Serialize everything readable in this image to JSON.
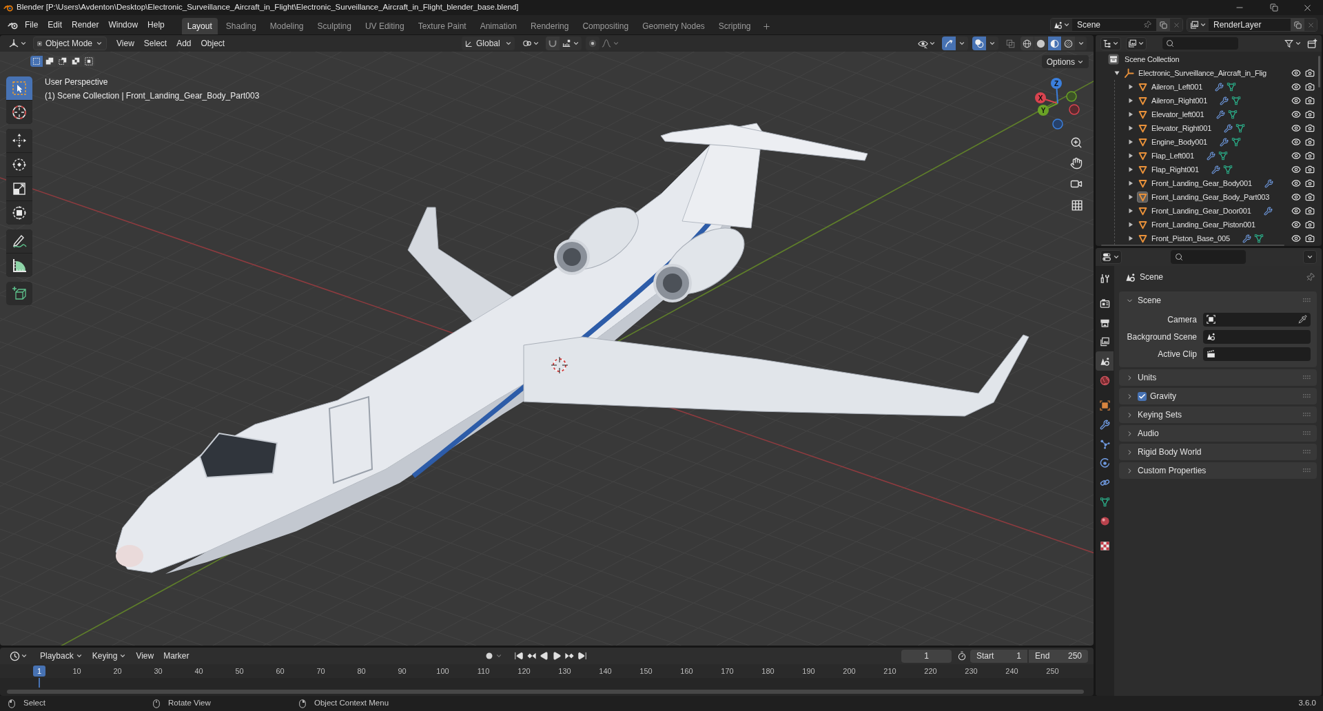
{
  "title_bar": {
    "title": "Blender [P:\\Users\\Avdenton\\Desktop\\Electronic_Surveillance_Aircraft_in_Flight\\Electronic_Surveillance_Aircraft_in_Flight_blender_base.blend]"
  },
  "menu": [
    "File",
    "Edit",
    "Render",
    "Window",
    "Help"
  ],
  "workspaces": [
    {
      "label": "Layout",
      "selected": true
    },
    {
      "label": "Shading",
      "selected": false
    },
    {
      "label": "Modeling",
      "selected": false
    },
    {
      "label": "Sculpting",
      "selected": false
    },
    {
      "label": "UV Editing",
      "selected": false
    },
    {
      "label": "Texture Paint",
      "selected": false
    },
    {
      "label": "Animation",
      "selected": false
    },
    {
      "label": "Rendering",
      "selected": false
    },
    {
      "label": "Compositing",
      "selected": false
    },
    {
      "label": "Geometry Nodes",
      "selected": false
    },
    {
      "label": "Scripting",
      "selected": false
    }
  ],
  "scene_selector": {
    "value": "Scene"
  },
  "view_layer_selector": {
    "value": "RenderLayer"
  },
  "viewport_header": {
    "mode": "Object Mode",
    "menus": [
      "View",
      "Select",
      "Add",
      "Object"
    ],
    "orientation": "Global",
    "snap": false,
    "proportional_editing": false,
    "gizmos": true,
    "overlays": true,
    "xray": false,
    "shading": [
      {
        "kind": "wireframe",
        "selected": false
      },
      {
        "kind": "solid",
        "selected": false
      },
      {
        "kind": "material",
        "selected": true
      },
      {
        "kind": "rendered",
        "selected": false
      }
    ]
  },
  "viewport": {
    "select_modes": [
      {
        "kind": "set",
        "selected": true
      },
      {
        "kind": "extend",
        "selected": false
      },
      {
        "kind": "subtract",
        "selected": false
      },
      {
        "kind": "invert",
        "selected": false
      },
      {
        "kind": "intersect",
        "selected": false
      }
    ],
    "options": "Options",
    "view_name": "User Perspective",
    "context": "(1) Scene Collection | Front_Landing_Gear_Body_Part003",
    "tool_groups": [
      [
        {
          "kind": "select_box",
          "selected": true
        },
        {
          "kind": "cursor",
          "selected": false
        }
      ],
      [
        {
          "kind": "move",
          "selected": false
        },
        {
          "kind": "rotate",
          "selected": false
        },
        {
          "kind": "scale",
          "selected": false
        },
        {
          "kind": "transform",
          "selected": false
        }
      ],
      [
        {
          "kind": "annotate",
          "selected": false
        },
        {
          "kind": "measure",
          "selected": false
        }
      ],
      [
        {
          "kind": "add_cube",
          "selected": false
        }
      ]
    ],
    "gizmo_axes": [
      "X",
      "Y",
      "Z"
    ]
  },
  "outliner": {
    "root": "Scene Collection",
    "collection": {
      "name": "Electronic_Surveillance_Aircraft_in_Flig",
      "expanded": true,
      "visible": true,
      "children": [
        {
          "name": "Aileron_Left001",
          "expanded": false,
          "selected": false,
          "visible": true,
          "modifier": true,
          "mesh_data": true
        },
        {
          "name": "Aileron_Right001",
          "expanded": false,
          "selected": false,
          "visible": true,
          "modifier": true,
          "mesh_data": true
        },
        {
          "name": "Elevator_left001",
          "expanded": false,
          "selected": false,
          "visible": true,
          "modifier": true,
          "mesh_data": true
        },
        {
          "name": "Elevator_Right001",
          "expanded": false,
          "selected": false,
          "visible": true,
          "modifier": true,
          "mesh_data": true
        },
        {
          "name": "Engine_Body001",
          "expanded": false,
          "selected": false,
          "visible": true,
          "modifier": true,
          "mesh_data": true
        },
        {
          "name": "Flap_Left001",
          "expanded": false,
          "selected": false,
          "visible": true,
          "modifier": true,
          "mesh_data": true
        },
        {
          "name": "Flap_Right001",
          "expanded": false,
          "selected": false,
          "visible": true,
          "modifier": true,
          "mesh_data": true
        },
        {
          "name": "Front_Landing_Gear_Body001",
          "expanded": false,
          "selected": false,
          "visible": true,
          "modifier": true,
          "mesh_data": false
        },
        {
          "name": "Front_Landing_Gear_Body_Part003",
          "expanded": false,
          "selected": true,
          "visible": true,
          "modifier": false,
          "mesh_data": false
        },
        {
          "name": "Front_Landing_Gear_Door001",
          "expanded": false,
          "selected": false,
          "visible": true,
          "modifier": true,
          "mesh_data": false
        },
        {
          "name": "Front_Landing_Gear_Piston001",
          "expanded": false,
          "selected": false,
          "visible": true,
          "modifier": false,
          "mesh_data": false
        },
        {
          "name": "Front_Piston_Base_005",
          "expanded": false,
          "selected": false,
          "visible": true,
          "modifier": true,
          "mesh_data": true
        }
      ]
    }
  },
  "properties": {
    "tab_groups": [
      [
        {
          "kind": "tool",
          "selected": false
        }
      ],
      [
        {
          "kind": "render",
          "selected": false
        },
        {
          "kind": "output",
          "selected": false
        },
        {
          "kind": "view_layer",
          "selected": false
        },
        {
          "kind": "scene",
          "selected": true
        },
        {
          "kind": "world",
          "selected": false
        }
      ],
      [
        {
          "kind": "object",
          "selected": false
        },
        {
          "kind": "modifiers",
          "selected": false
        },
        {
          "kind": "particles",
          "selected": false
        },
        {
          "kind": "physics",
          "selected": false
        },
        {
          "kind": "constraints",
          "selected": false
        },
        {
          "kind": "data",
          "selected": false
        },
        {
          "kind": "material",
          "selected": false
        }
      ],
      [
        {
          "kind": "texture",
          "selected": false
        }
      ]
    ],
    "context": "Scene",
    "panels": [
      {
        "kind": "plain",
        "title": "Scene",
        "expanded": true,
        "fields": [
          {
            "label": "Camera",
            "kind": "camera"
          },
          {
            "label": "Background Scene",
            "kind": "scene"
          },
          {
            "label": "Active Clip",
            "kind": "clip"
          }
        ]
      },
      {
        "kind": "plain",
        "title": "Units",
        "expanded": false
      },
      {
        "kind": "checkbox",
        "title": "Gravity",
        "expanded": false,
        "checked": true
      },
      {
        "kind": "plain",
        "title": "Keying Sets",
        "expanded": false
      },
      {
        "kind": "plain",
        "title": "Audio",
        "expanded": false
      },
      {
        "kind": "plain",
        "title": "Rigid Body World",
        "expanded": false
      },
      {
        "kind": "plain",
        "title": "Custom Properties",
        "expanded": false
      }
    ]
  },
  "timeline": {
    "menus": [
      {
        "label": "Playback",
        "dropdown": true
      },
      {
        "label": "Keying",
        "dropdown": true
      },
      {
        "label": "View",
        "dropdown": false
      },
      {
        "label": "Marker",
        "dropdown": false
      }
    ],
    "current_frame": "1",
    "start": {
      "label": "Start",
      "value": "1"
    },
    "end": {
      "label": "End",
      "value": "250"
    },
    "playhead": "1",
    "ruler": [
      "10",
      "20",
      "30",
      "40",
      "50",
      "60",
      "70",
      "80",
      "90",
      "100",
      "110",
      "120",
      "130",
      "140",
      "150",
      "160",
      "170",
      "180",
      "190",
      "200",
      "210",
      "220",
      "230",
      "240",
      "250"
    ]
  },
  "status_bar": {
    "hints": [
      {
        "kind": "left",
        "label": "Select"
      },
      {
        "kind": "middle",
        "label": "Rotate View"
      },
      {
        "kind": "right",
        "label": "Object Context Menu"
      }
    ],
    "version": "3.6.0"
  }
}
